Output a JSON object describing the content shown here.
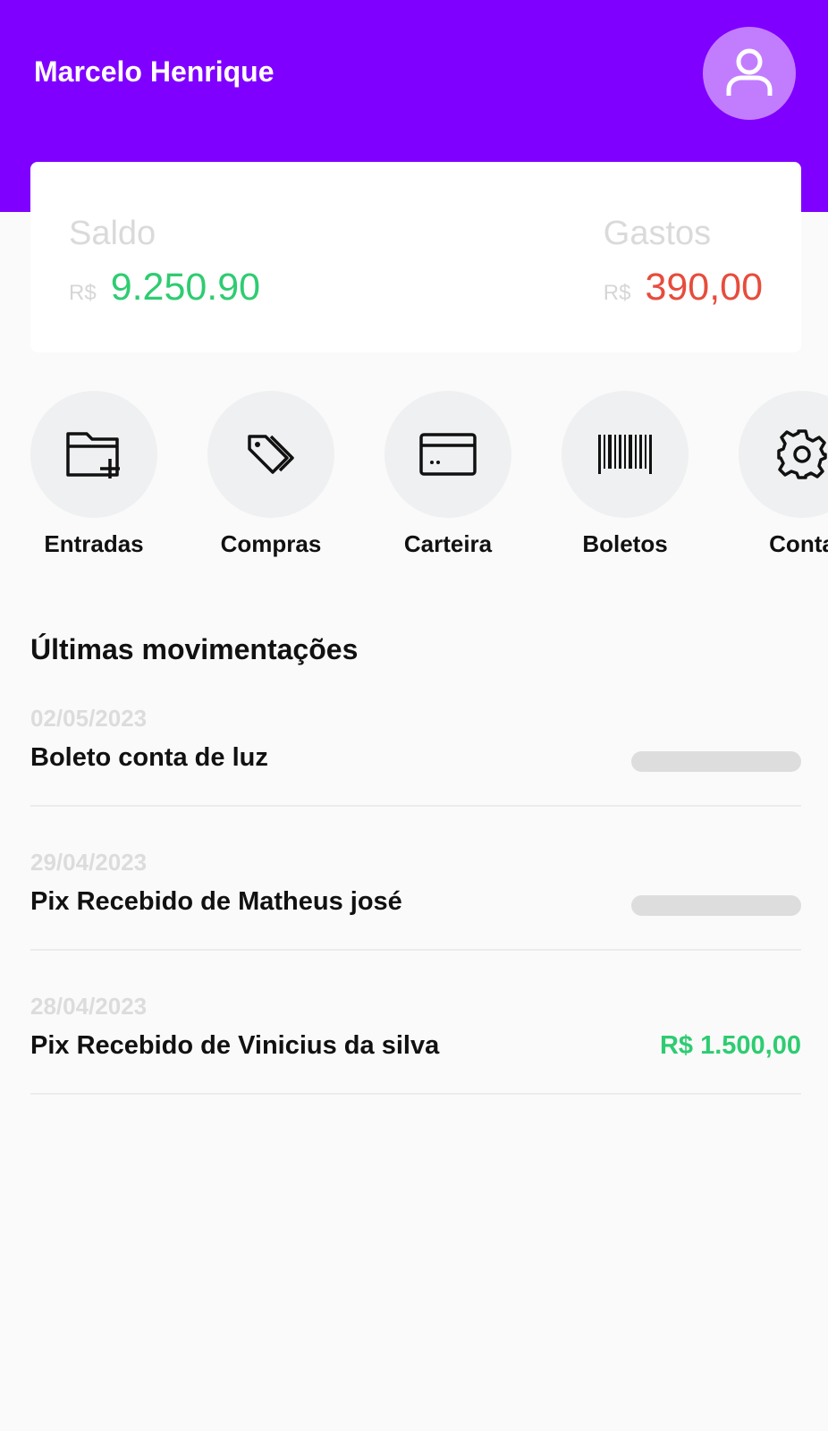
{
  "header": {
    "user_name": "Marcelo Henrique",
    "avatar_icon": "user-icon",
    "background_color": "#8000ff"
  },
  "balance_card": {
    "saldo": {
      "label": "Saldo",
      "currency": "R$",
      "value": "9.250.90",
      "color": "#2ecc71"
    },
    "gastos": {
      "label": "Gastos",
      "currency": "R$",
      "value": "390,00",
      "color": "#e74c3c"
    }
  },
  "actions": [
    {
      "label": "Entradas",
      "icon": "folder-plus-icon"
    },
    {
      "label": "Compras",
      "icon": "tags-icon"
    },
    {
      "label": "Carteira",
      "icon": "credit-card-icon"
    },
    {
      "label": "Boletos",
      "icon": "barcode-icon"
    },
    {
      "label": "Conta",
      "icon": "gear-icon"
    }
  ],
  "movements": {
    "title": "Últimas movimentações",
    "items": [
      {
        "date": "02/05/2023",
        "description": "Boleto conta de luz",
        "amount": "",
        "amount_hidden": true
      },
      {
        "date": "29/04/2023",
        "description": "Pix Recebido de Matheus josé",
        "amount": "",
        "amount_hidden": true
      },
      {
        "date": "28/04/2023",
        "description": "Pix Recebido de Vinicius da silva",
        "amount": "R$ 1.500,00",
        "amount_hidden": false
      }
    ]
  }
}
